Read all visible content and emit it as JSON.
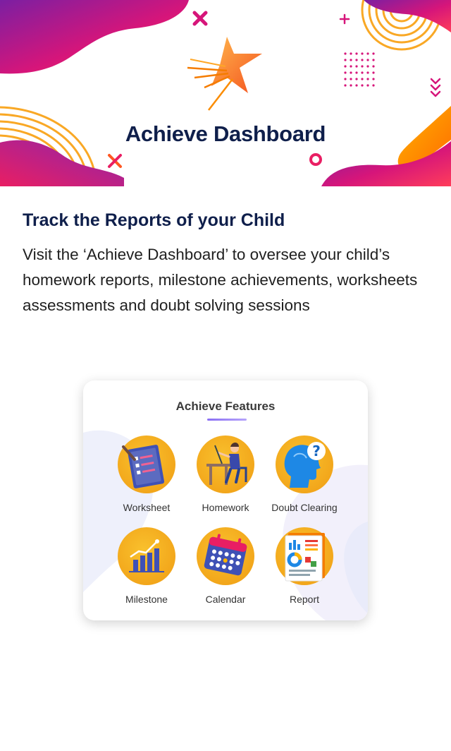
{
  "banner": {
    "title": "Achieve Dashboard"
  },
  "section": {
    "heading": "Track the Reports of your Child",
    "body": "Visit the ‘Achieve Dashboard’ to oversee your child’s homework reports, milestone achievements, worksheets assessments and doubt solving sessions"
  },
  "card": {
    "title": "Achieve Features",
    "features": [
      {
        "label": "Worksheet",
        "icon": "todo-list-icon"
      },
      {
        "label": "Homework",
        "icon": "student-at-desk-icon"
      },
      {
        "label": "Doubt Clearing",
        "icon": "head-question-icon"
      },
      {
        "label": "Milestone",
        "icon": "bar-chart-growth-icon"
      },
      {
        "label": "Calendar",
        "icon": "calendar-icon"
      },
      {
        "label": "Report",
        "icon": "report-document-icon"
      }
    ]
  },
  "colors": {
    "heading": "#0f1f4b",
    "magenta": "#d6157a",
    "purple": "#7a1fa2",
    "orange": "#f7a21b",
    "icon_disc": "#f5ad1e"
  }
}
